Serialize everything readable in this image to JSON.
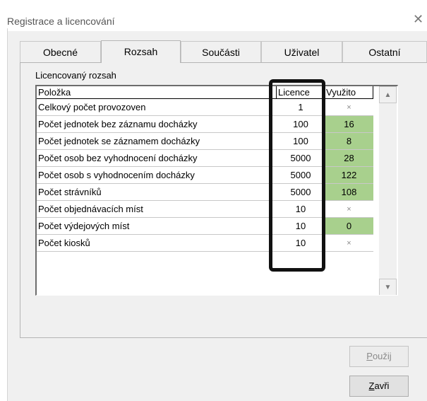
{
  "window": {
    "title": "Registrace a licencování"
  },
  "tabs": [
    {
      "label": "Obecné",
      "active": false
    },
    {
      "label": "Rozsah",
      "active": true
    },
    {
      "label": "Součásti",
      "active": false
    },
    {
      "label": "Uživatel",
      "active": false
    },
    {
      "label": "Ostatní",
      "active": false
    }
  ],
  "group_label": "Licencovaný rozsah",
  "table": {
    "columns": [
      "Položka",
      "Licence",
      "Využito"
    ],
    "rows": [
      {
        "name": "Celkový počet provozoven",
        "licence": "1",
        "used": "×",
        "used_highlight": false
      },
      {
        "name": "Počet jednotek bez záznamu docházky",
        "licence": "100",
        "used": "16",
        "used_highlight": true
      },
      {
        "name": "Počet jednotek se záznamem docházky",
        "licence": "100",
        "used": "8",
        "used_highlight": true
      },
      {
        "name": "Počet osob bez vyhodnocení docházky",
        "licence": "5000",
        "used": "28",
        "used_highlight": true
      },
      {
        "name": "Počet osob s vyhodnocením docházky",
        "licence": "5000",
        "used": "122",
        "used_highlight": true
      },
      {
        "name": "Počet strávníků",
        "licence": "5000",
        "used": "108",
        "used_highlight": true
      },
      {
        "name": "Počet objednávacích míst",
        "licence": "10",
        "used": "×",
        "used_highlight": false
      },
      {
        "name": "Počet výdejových míst",
        "licence": "10",
        "used": "0",
        "used_highlight": true
      },
      {
        "name": "Počet kiosků",
        "licence": "10",
        "used": "×",
        "used_highlight": false
      }
    ]
  },
  "colors": {
    "used_highlight": "#a8d08d",
    "highlight_frame": "#111111"
  },
  "buttons": {
    "apply": {
      "mnemonic": "P",
      "rest": "oužij",
      "enabled": false
    },
    "close": {
      "mnemonic": "Z",
      "rest": "avři",
      "enabled": true
    }
  },
  "icons": {
    "close": "close-icon",
    "scroll_up": "scroll-up-arrow-icon",
    "scroll_down": "scroll-down-arrow-icon"
  }
}
